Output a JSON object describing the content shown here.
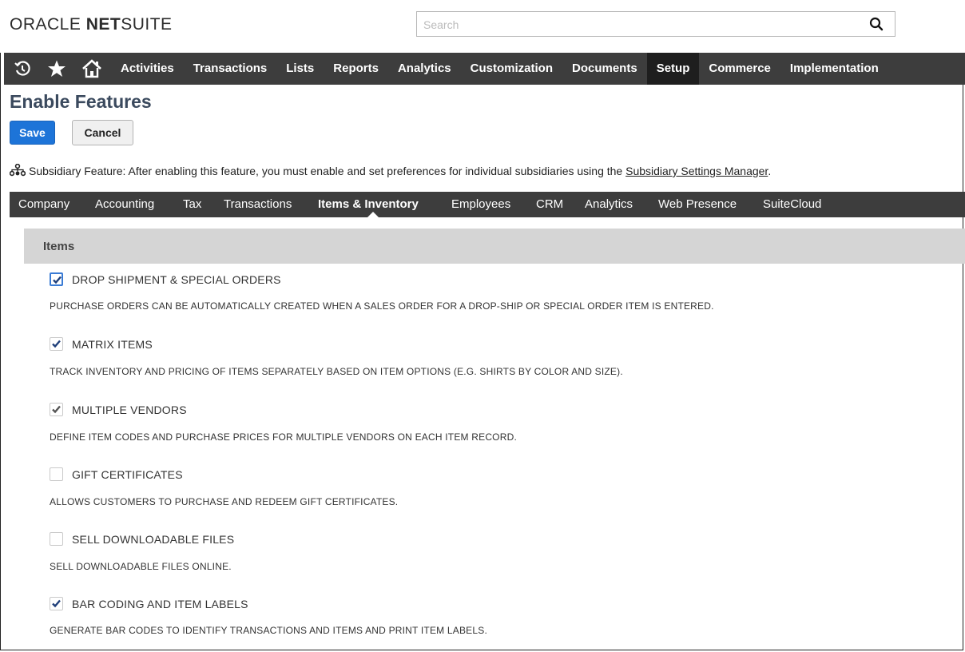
{
  "header": {
    "logo": {
      "part1": "ORACLE ",
      "part2": "NET",
      "part3": "SUITE"
    },
    "search_placeholder": "Search"
  },
  "nav": {
    "items": [
      "Activities",
      "Transactions",
      "Lists",
      "Reports",
      "Analytics",
      "Customization",
      "Documents",
      "Setup",
      "Commerce",
      "Implementation"
    ],
    "active": "Setup"
  },
  "page": {
    "title": "Enable Features",
    "save_label": "Save",
    "cancel_label": "Cancel",
    "notice_text": "Subsidiary Feature: After enabling this feature, you must enable and set preferences for individual subsidiaries using the ",
    "notice_link": "Subsidiary Settings Manager",
    "notice_end": "."
  },
  "tabs": {
    "items": [
      "Company",
      "Accounting",
      "Tax",
      "Transactions",
      "Items & Inventory",
      "Employees",
      "CRM",
      "Analytics",
      "Web Presence",
      "SuiteCloud"
    ],
    "active": "Items & Inventory"
  },
  "section": {
    "title": "Items",
    "features": [
      {
        "label": "DROP SHIPMENT & SPECIAL ORDERS",
        "description": "PURCHASE ORDERS CAN BE AUTOMATICALLY CREATED WHEN A SALES ORDER FOR A DROP-SHIP OR SPECIAL ORDER ITEM IS ENTERED.",
        "checked": true
      },
      {
        "label": "MATRIX ITEMS",
        "description": "TRACK INVENTORY AND PRICING OF ITEMS SEPARATELY BASED ON ITEM OPTIONS (E.G. SHIRTS BY COLOR AND SIZE).",
        "checked": true
      },
      {
        "label": "MULTIPLE VENDORS",
        "description": "DEFINE ITEM CODES AND PURCHASE PRICES FOR MULTIPLE VENDORS ON EACH ITEM RECORD.",
        "checked": true
      },
      {
        "label": "GIFT CERTIFICATES",
        "description": "ALLOWS CUSTOMERS TO PURCHASE AND REDEEM GIFT CERTIFICATES.",
        "checked": false
      },
      {
        "label": "SELL DOWNLOADABLE FILES",
        "description": "SELL DOWNLOADABLE FILES ONLINE.",
        "checked": false
      },
      {
        "label": "BAR CODING AND ITEM LABELS",
        "description": "GENERATE BAR CODES TO IDENTIFY TRANSACTIONS AND ITEMS AND PRINT ITEM LABELS.",
        "checked": true
      }
    ]
  },
  "colors": {
    "nav_bg": "#3d3d3d",
    "save_blue": "#1d74d8",
    "title": "#3b4a5e",
    "section_bg": "#d5d5d5",
    "check": "#1f3f7a"
  }
}
